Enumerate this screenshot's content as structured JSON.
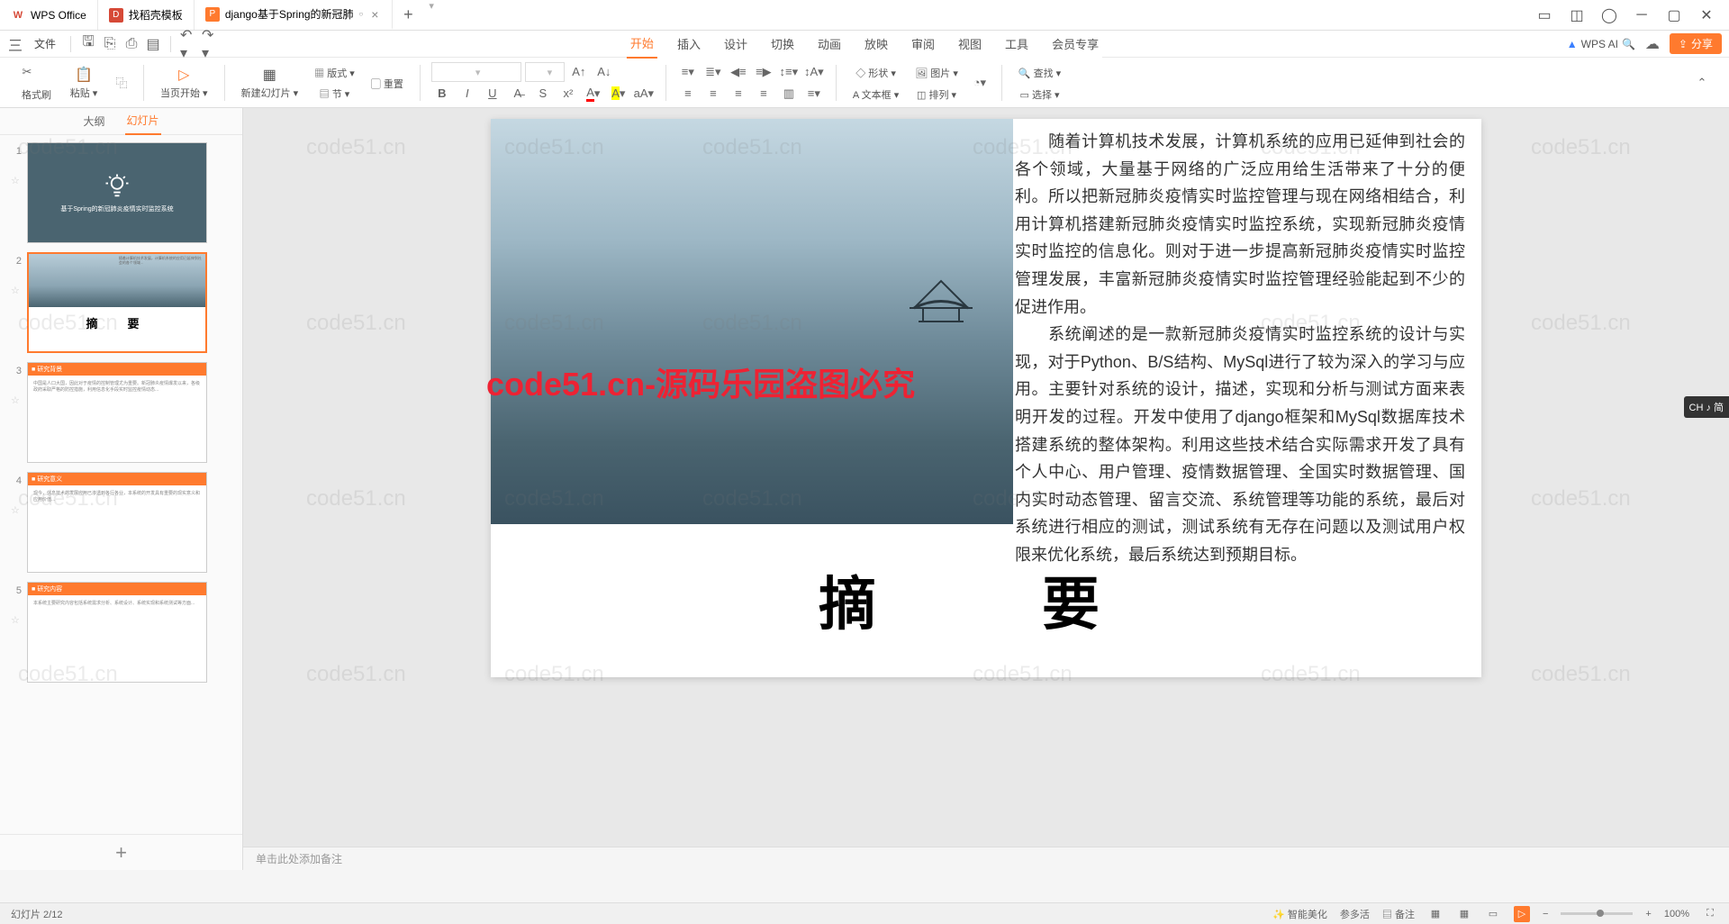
{
  "titlebar": {
    "tabs": [
      {
        "icon": "wps",
        "label": "WPS Office",
        "color": "#d64937"
      },
      {
        "icon": "d",
        "label": "找稻壳模板",
        "color": "#d64937"
      },
      {
        "icon": "p",
        "label": "django基于Spring的新冠肺",
        "color": "#ff7a2e",
        "active": true
      }
    ],
    "newtab": "+"
  },
  "quickbar": {
    "menu": "三",
    "file": "文件",
    "cloud_label": "云",
    "wps_ai": "WPS AI",
    "share": "分享"
  },
  "ribbon_tabs": [
    "开始",
    "插入",
    "设计",
    "切换",
    "动画",
    "放映",
    "审阅",
    "视图",
    "工具",
    "会员专享"
  ],
  "ribbon_active": 0,
  "ribbon": {
    "format_painter": "格式刷",
    "paste": "粘贴",
    "start_from": "当页开始",
    "new_slide": "新建幻灯片",
    "layout": "版式",
    "section": "节",
    "reset": "重置",
    "shape": "形状",
    "picture": "图片",
    "textbox": "文本框",
    "arrange": "排列",
    "find": "查找",
    "select": "选择"
  },
  "panel": {
    "outline": "大纲",
    "slides": "幻灯片"
  },
  "thumbnails": [
    {
      "num": "1",
      "type": "title",
      "title_text": "基于Spring的新冠肺炎疫情实时监控系统"
    },
    {
      "num": "2",
      "type": "abstract",
      "title": "摘　要",
      "selected": true
    },
    {
      "num": "3",
      "type": "section",
      "header": "研究背景"
    },
    {
      "num": "4",
      "type": "section",
      "header": "研究意义"
    },
    {
      "num": "5",
      "type": "section",
      "header": "研究内容"
    }
  ],
  "slide": {
    "body_text": "　　随着计算机技术发展，计算机系统的应用已延伸到社会的各个领域，大量基于网络的广泛应用给生活带来了十分的便利。所以把新冠肺炎疫情实时监控管理与现在网络相结合，利用计算机搭建新冠肺炎疫情实时监控系统，实现新冠肺炎疫情实时监控的信息化。则对于进一步提高新冠肺炎疫情实时监控管理发展，丰富新冠肺炎疫情实时监控管理经验能起到不少的促进作用。\n　　系统阐述的是一款新冠肺炎疫情实时监控系统的设计与实现，对于Python、B/S结构、MySql进行了较为深入的学习与应用。主要针对系统的设计，描述，实现和分析与测试方面来表明开发的过程。开发中使用了django框架和MySql数据库技术搭建系统的整体架构。利用这些技术结合实际需求开发了具有个人中心、用户管理、疫情数据管理、全国实时数据管理、国内实时动态管理、留言交流、系统管理等功能的系统，最后对系统进行相应的测试，测试系统有无存在问题以及测试用户权限来优化系统，最后系统达到预期目标。",
    "title": "摘　要"
  },
  "notes_placeholder": "单击此处添加备注",
  "watermark": "code51.cn",
  "watermark_red": "code51.cn-源码乐园盗图必究",
  "ime": "CH ♪ 简",
  "status": {
    "slide_info": "幻灯片 2/12",
    "smart_beautify": "智能美化",
    "sections": "参多活",
    "notes": "备注",
    "zoom": "100%"
  }
}
